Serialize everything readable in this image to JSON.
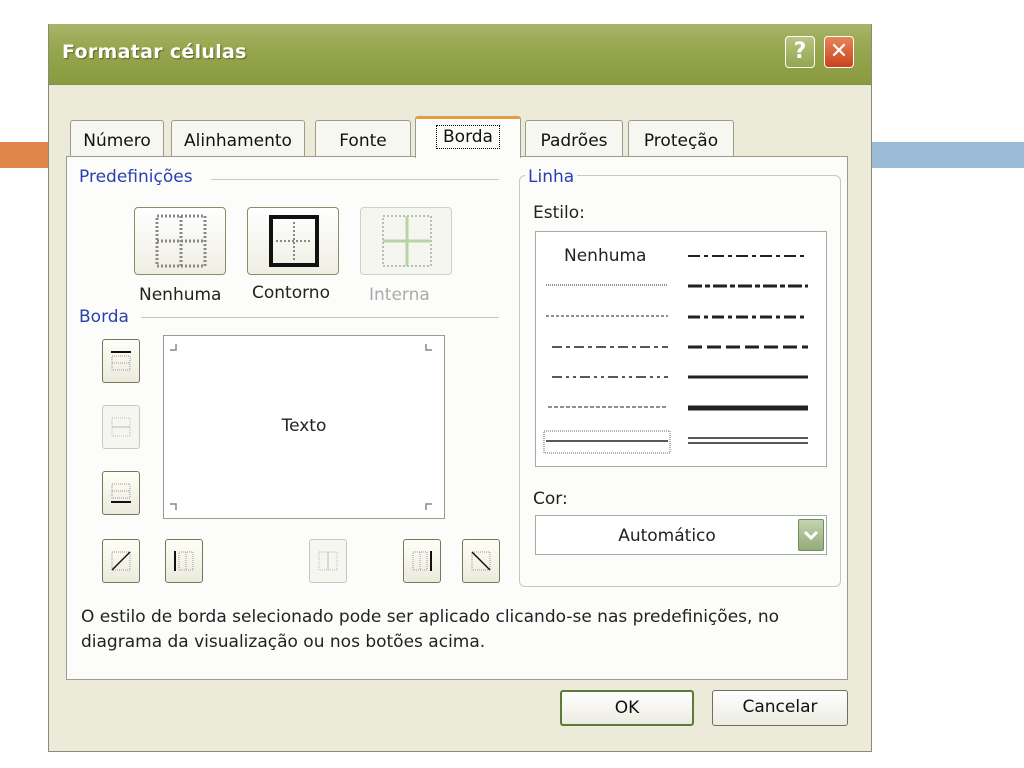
{
  "window": {
    "title": "Formatar células",
    "help_label": "?",
    "close_label": "✕"
  },
  "tabs": [
    {
      "label": "Número",
      "active": false
    },
    {
      "label": "Alinhamento",
      "active": false
    },
    {
      "label": "Fonte",
      "active": false
    },
    {
      "label": "Borda",
      "active": true
    },
    {
      "label": "Padrões",
      "active": false
    },
    {
      "label": "Proteção",
      "active": false
    }
  ],
  "presets": {
    "group_label": "Predefinições",
    "none_label": "Nenhuma",
    "outline_label": "Contorno",
    "inside_label": "Interna"
  },
  "border": {
    "group_label": "Borda",
    "preview_text": "Texto"
  },
  "line": {
    "group_label": "Linha",
    "style_label": "Estilo:",
    "none_style_label": "Nenhuma",
    "color_label": "Cor:",
    "color_value": "Automático"
  },
  "info_text": "O estilo de borda selecionado pode ser aplicado clicando-se nas predefinições, no diagrama da visualização ou nos botões acima.",
  "buttons": {
    "ok": "OK",
    "cancel": "Cancelar"
  },
  "colors": {
    "accent": "#e59b3f",
    "title_bar": "#97a74f",
    "group_label": "#2a3fb0"
  }
}
